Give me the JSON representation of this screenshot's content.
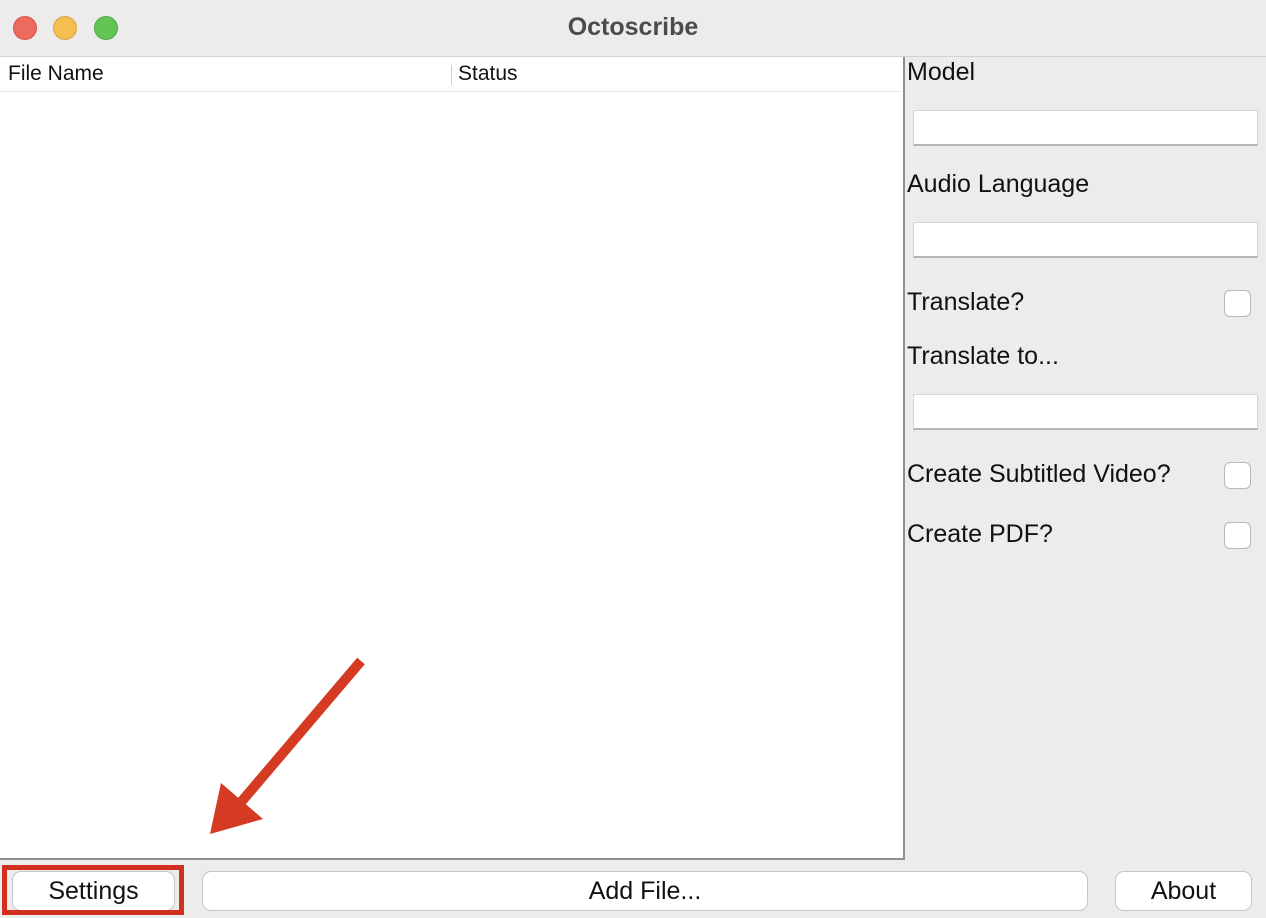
{
  "window": {
    "title": "Octoscribe"
  },
  "table": {
    "columns": [
      "File Name",
      "Status"
    ],
    "rows": []
  },
  "side_panel": {
    "model_label": "Model",
    "model_value": "",
    "audio_language_label": "Audio Language",
    "audio_language_value": "",
    "translate_label": "Translate?",
    "translate_checked": false,
    "translate_to_label": "Translate to...",
    "translate_to_value": "",
    "subtitled_video_label": "Create Subtitled Video?",
    "subtitled_video_checked": false,
    "create_pdf_label": "Create PDF?",
    "create_pdf_checked": false
  },
  "buttons": {
    "settings": "Settings",
    "add_file": "Add File...",
    "about": "About"
  },
  "annotation": {
    "highlight_target": "settings-button",
    "color": "#d32f1f"
  }
}
